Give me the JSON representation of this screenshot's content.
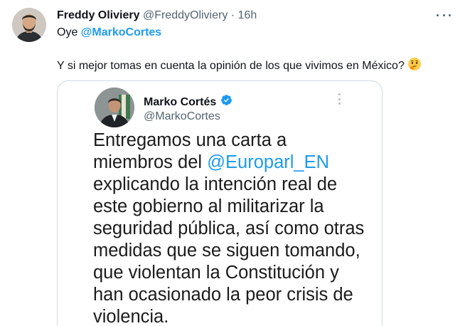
{
  "tweet": {
    "author_name": "Freddy Oliviery",
    "author_handle": "@FreddyOliviery",
    "separator": " · ",
    "time": "16h",
    "line1_prefix": "Oye ",
    "line1_mention": "@MarkoCortes",
    "line2_text": "Y si mejor tomas en cuenta la opinión de los que vivimos en México?",
    "emoji": "thinking-face-emoji"
  },
  "quoted": {
    "name": "Marko Cortés",
    "handle": "@MarkoCortes",
    "verified_icon": "verified-badge-icon",
    "lines": {
      "l1": "Entregamos una carta a",
      "l2_prefix": "miembros del ",
      "l2_link": "@Europarl_EN",
      "l3": "explicando la intención real de",
      "l4": "este gobierno al militarizar la",
      "l5": "seguridad pública, así como otras",
      "l6": "medidas que se siguen tomando,",
      "l7": "que violentan la Constitución y",
      "l8": "han ocasionado la peor crisis de",
      "l9": "violencia."
    }
  },
  "colors": {
    "link": "#1d9bf0",
    "secondary_text": "#536471",
    "border": "#cfd9de",
    "verified": "#1d9bf0"
  }
}
